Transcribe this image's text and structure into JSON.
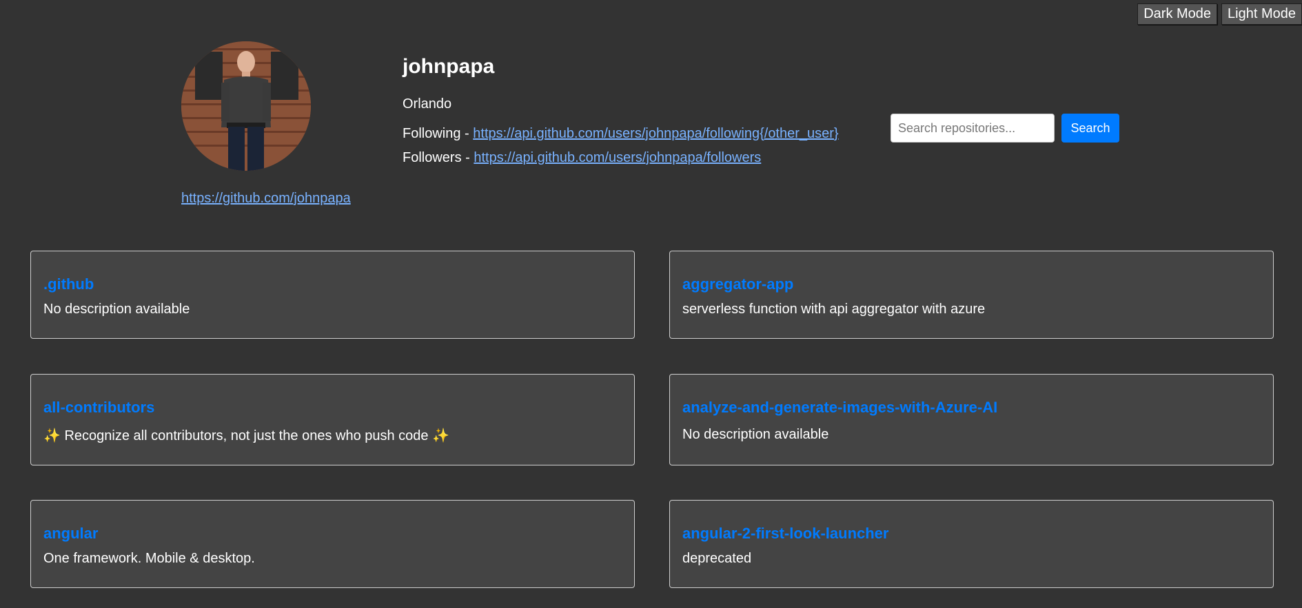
{
  "theme_toggles": {
    "dark_label": "Dark Mode",
    "light_label": "Light Mode"
  },
  "profile": {
    "username": "johnpapa",
    "location": "Orlando",
    "profile_url": "https://github.com/johnpapa",
    "following_label": "Following - ",
    "following_url": "https://api.github.com/users/johnpapa/following{/other_user}",
    "followers_label": "Followers - ",
    "followers_url": "https://api.github.com/users/johnpapa/followers"
  },
  "search": {
    "placeholder": "Search repositories...",
    "button_label": "Search"
  },
  "repositories": [
    {
      "name": ".github",
      "description": "No description available"
    },
    {
      "name": "aggregator-app",
      "description": "serverless function with api aggregator with azure"
    },
    {
      "name": "all-contributors",
      "description": "✨ Recognize all contributors, not just the ones who push code ✨"
    },
    {
      "name": "analyze-and-generate-images-with-Azure-AI",
      "description": "No description available"
    },
    {
      "name": "angular",
      "description": "One framework. Mobile & desktop."
    },
    {
      "name": "angular-2-first-look-launcher",
      "description": "deprecated"
    }
  ],
  "colors": {
    "background": "#333333",
    "card_background": "#444444",
    "accent": "#007bff",
    "link": "#79b2ff"
  }
}
